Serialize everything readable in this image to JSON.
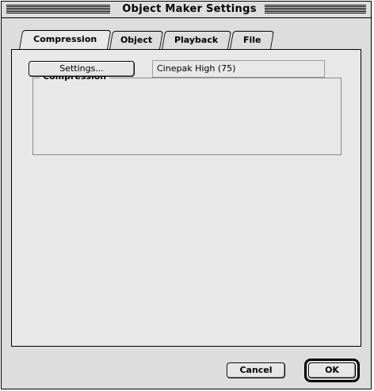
{
  "window": {
    "title": "Object Maker Settings"
  },
  "tabs": [
    {
      "label": "Compression",
      "active": true
    },
    {
      "label": "Object",
      "active": false
    },
    {
      "label": "Playback",
      "active": false
    },
    {
      "label": "File",
      "active": false
    }
  ],
  "compression_group": {
    "title": "Compression",
    "settings_button": "Settings...",
    "current_value": "Cinepak High (75)"
  },
  "buttons": {
    "cancel": "Cancel",
    "ok": "OK"
  }
}
